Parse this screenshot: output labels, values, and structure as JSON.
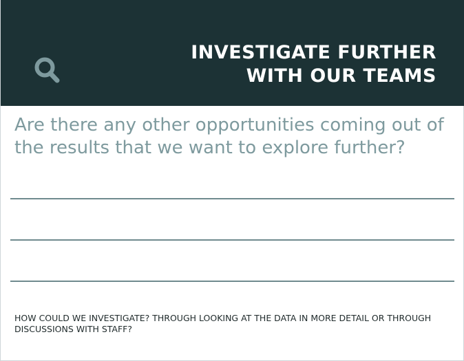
{
  "header": {
    "icon": "search-icon",
    "title_line1": "INVESTIGATE FURTHER",
    "title_line2": "WITH OUR TEAMS",
    "background_color": "#1c3235"
  },
  "prompt": {
    "question": "Are there any other opportunities coming out of the results that we want to explore further?",
    "question_color": "#7e9a9e"
  },
  "answer_lines": [
    {
      "value": ""
    },
    {
      "value": ""
    },
    {
      "value": ""
    }
  ],
  "footer": {
    "hint": "HOW COULD WE INVESTIGATE? THROUGH LOOKING AT THE DATA IN MORE DETAIL OR THROUGH DISCUSSIONS WITH STAFF?"
  }
}
